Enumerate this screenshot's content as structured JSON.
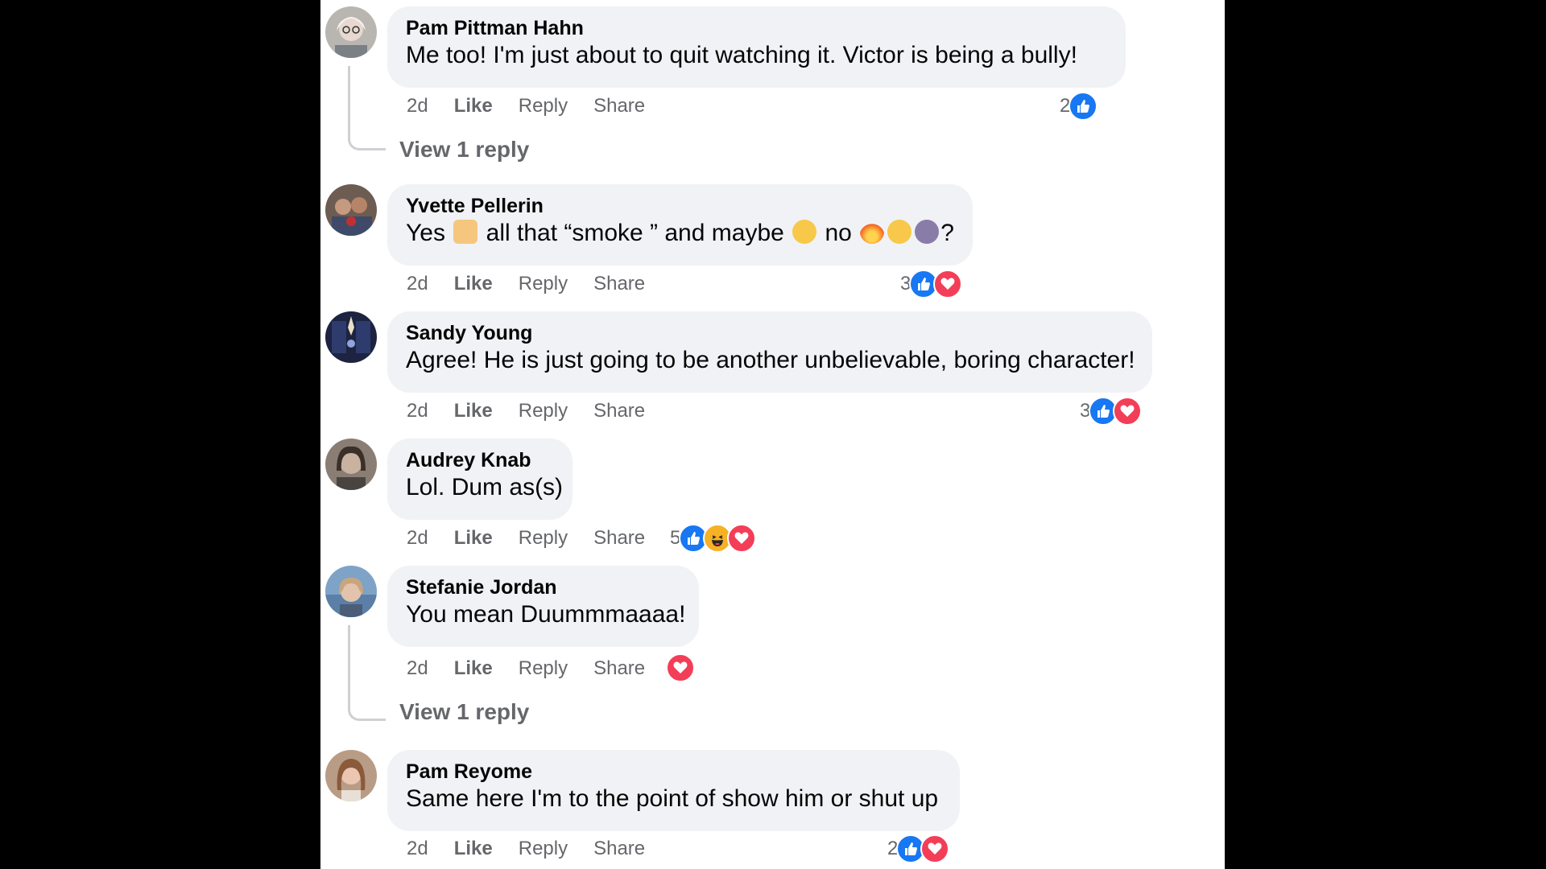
{
  "comments": [
    {
      "author": "Pam Pittman Hahn",
      "text": "Me too! I'm just about to quit watching it. Victor is being a bully!",
      "time": "2d",
      "like": "Like",
      "reply": "Reply",
      "share": "Share",
      "reaction_count": "2",
      "reactions": [
        "like"
      ],
      "view_replies": "View 1 reply"
    },
    {
      "author": "Yvette Pellerin",
      "text_parts": [
        "Yes",
        "all that “smoke ” and maybe",
        "no",
        "?"
      ],
      "emojis": [
        "thumbs-up-emoji",
        "sick-face-emoji",
        "fire-emoji",
        "unamused-face-emoji",
        "person-facepalming-emoji"
      ],
      "time": "2d",
      "like": "Like",
      "reply": "Reply",
      "share": "Share",
      "reaction_count": "3",
      "reactions": [
        "like",
        "love"
      ]
    },
    {
      "author": "Sandy Young",
      "text": "Agree! He is just going to be another unbelievable, boring character!",
      "time": "2d",
      "like": "Like",
      "reply": "Reply",
      "share": "Share",
      "reaction_count": "3",
      "reactions": [
        "like",
        "love"
      ]
    },
    {
      "author": "Audrey Knab",
      "text": "Lol. Dum as(s)",
      "time": "2d",
      "like": "Like",
      "reply": "Reply",
      "share": "Share",
      "reaction_count": "5",
      "reactions": [
        "like",
        "haha",
        "love"
      ]
    },
    {
      "author": "Stefanie Jordan",
      "text": "You mean Duummmaaaa!",
      "time": "2d",
      "like": "Like",
      "reply": "Reply",
      "share": "Share",
      "reactions": [
        "love"
      ],
      "view_replies": "View 1 reply"
    },
    {
      "author": "Pam Reyome",
      "text": "Same here I'm to the point of show him or shut up",
      "time": "2d",
      "like": "Like",
      "reply": "Reply",
      "share": "Share",
      "reaction_count": "2",
      "reactions": [
        "like",
        "love"
      ]
    }
  ],
  "colors": {
    "like": "#1877f2",
    "love": "#f33e58",
    "haha": "#f7b125",
    "bubble": "#f0f2f5",
    "meta": "#65676b"
  }
}
